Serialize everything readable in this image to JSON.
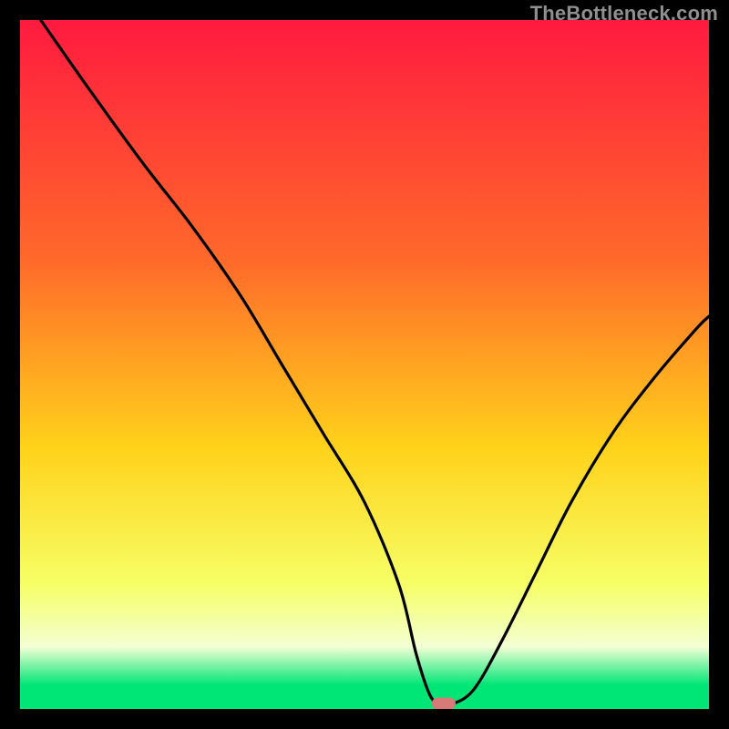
{
  "watermark": "TheBottleneck.com",
  "colors": {
    "top": "#ff1a3f",
    "mid_upper": "#ff6a2a",
    "mid": "#ffd21a",
    "mid_lower": "#f6ff66",
    "pale": "#f3ffd4",
    "green": "#00e676",
    "curve": "#000000",
    "marker": "#d87a78",
    "frame": "#000000"
  },
  "chart_data": {
    "type": "line",
    "title": "",
    "xlabel": "",
    "ylabel": "",
    "xlim": [
      0,
      100
    ],
    "ylim": [
      0,
      100
    ],
    "x": [
      3,
      10,
      18,
      25,
      32,
      38,
      44,
      50,
      55,
      57.5,
      59.5,
      61,
      63,
      66,
      70,
      75,
      80,
      86,
      92,
      98,
      100
    ],
    "values": [
      100,
      90,
      79,
      70,
      60,
      50,
      40,
      30,
      18,
      8,
      2,
      0.8,
      0.8,
      3,
      10,
      20,
      30,
      40,
      48,
      55,
      57
    ],
    "marker": {
      "x": 61.5,
      "y": 0.8
    },
    "green_band_top_y": 3.5,
    "pale_band_top_y": 9,
    "yellow_band_top_y": 18
  }
}
